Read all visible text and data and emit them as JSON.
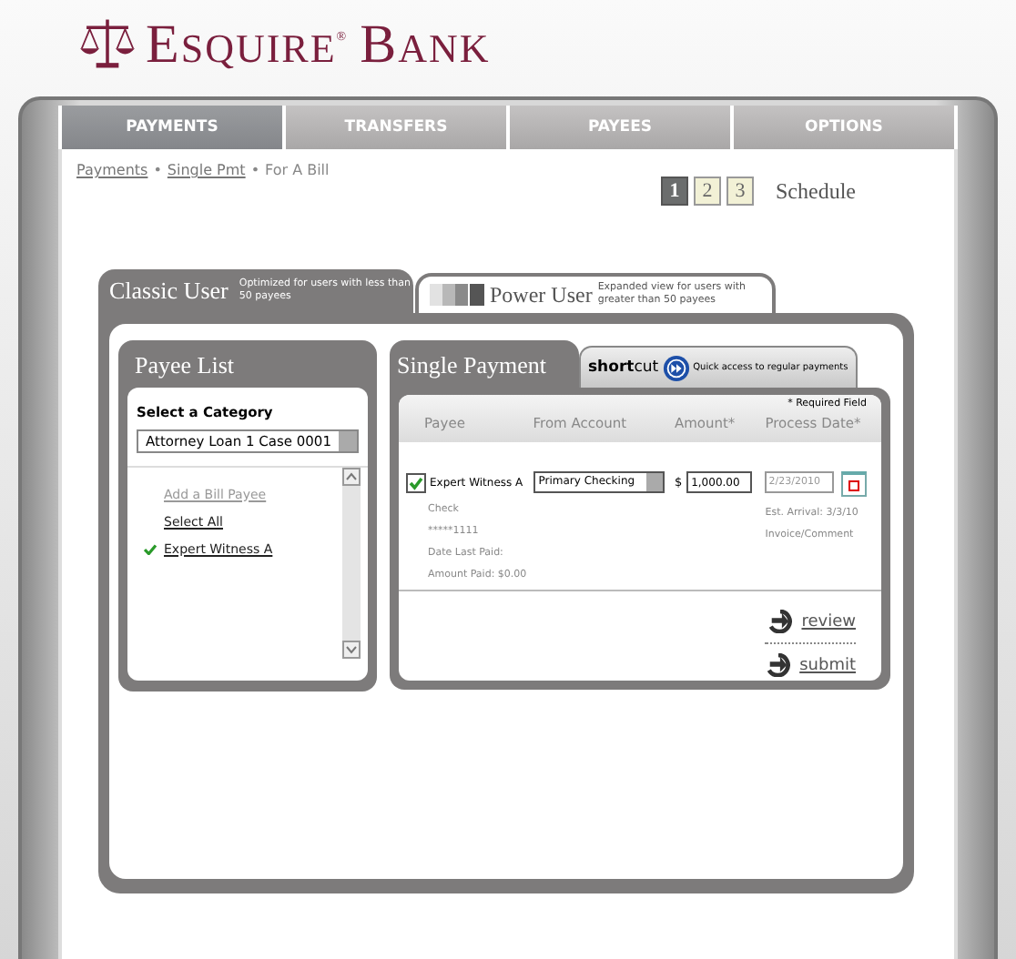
{
  "logo": {
    "first": "ESQUIRE",
    "mark": "®",
    "second": "BANK"
  },
  "nav": [
    {
      "label": "PAYMENTS",
      "selected": true
    },
    {
      "label": "TRANSFERS",
      "selected": false
    },
    {
      "label": "PAYEES",
      "selected": false
    },
    {
      "label": "OPTIONS",
      "selected": false
    }
  ],
  "breadcrumb": {
    "separator": "•",
    "items": [
      {
        "label": "Payments",
        "link": true
      },
      {
        "label": "Single Pmt",
        "link": true
      },
      {
        "label": "For A Bill",
        "link": false
      }
    ]
  },
  "steps": {
    "items": [
      {
        "label": "1",
        "selected": true
      },
      {
        "label": "2",
        "selected": false
      },
      {
        "label": "3",
        "selected": false
      }
    ],
    "title": "Schedule"
  },
  "modes": [
    {
      "title": "Classic User",
      "description": "Optimized for users with less than 50 payees",
      "selected": true
    },
    {
      "title": "Power User",
      "description": "Expanded view for users with greater than 50 payees",
      "selected": false
    }
  ],
  "payee_list": {
    "title": "Payee List",
    "category_label": "Select a Category",
    "category": "Attorney Loan 1 Case 0001",
    "items": [
      {
        "kind": "add",
        "label": "Add a Bill Payee"
      },
      {
        "kind": "link",
        "label": "Select All"
      },
      {
        "kind": "payee",
        "label": "Expert Witness A",
        "checked": true
      }
    ]
  },
  "single_payment": {
    "title": "Single Payment",
    "shortcut": {
      "brand_bold": "short",
      "brand_rest": "cut",
      "text": "Quick access to regular payments"
    },
    "required_note": "* Required Field",
    "columns": [
      "Payee",
      "From Account",
      "Amount*",
      "Process Date*"
    ],
    "row": {
      "checked": true,
      "payee": "Expert Witness A",
      "account": "Primary Checking",
      "currency": "$",
      "amount": "1,000.00",
      "date": "2/23/2010",
      "method": "Check",
      "account_number": "*****1111",
      "date_last_paid": "Date Last Paid:",
      "amount_paid": "Amount Paid: $0.00",
      "arrival": "Est. Arrival: 3/3/10",
      "comment": "Invoice/Comment"
    },
    "actions": [
      "review",
      "submit"
    ]
  }
}
